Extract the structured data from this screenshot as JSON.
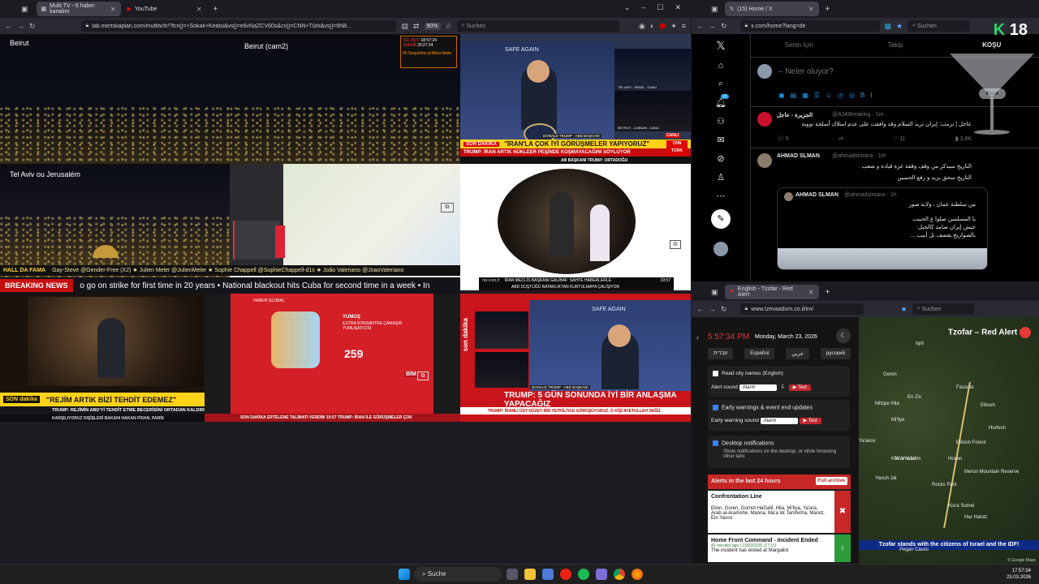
{
  "left_browser": {
    "tabs": [
      {
        "label": "Multi TV - 6 haber kanalını"
      },
      {
        "label": "YouTube"
      }
    ],
    "url": "lab.mertskaplan.com/multitv/tr/?fcn[]=+Sokak+Kedisi&vs[]=e6vNaZCV60s&cn[]=CNN+Türk&vs[]=6N8...",
    "zoom": "90%",
    "search_placeholder": "Suchen"
  },
  "tv_tiles": {
    "beirut": "Beirut",
    "beirut_cam2": "Beirut (cam2)",
    "tel_aviv": "Tel Aviv ou Jerusalém",
    "clock_city1": "TEL AVIV",
    "clock_time1": "18:57:24",
    "clock_city2": "TEERÃ",
    "clock_time2": "20:27:24",
    "clock_note": "05 Segundos pl Meia-Noite",
    "cnn_son_dakika": "SON DAKİKA",
    "cnn_headline": "\"İRAN'LA ÇOK İYİ GÖRÜŞMELER YAPIYORUZ\"",
    "cnn_sub": "TRUMP: İRAN ARTIK NÜKLEER PEŞİNDE KOŞMAYACAĞINI SÖYLÜYOR",
    "cnn_canli": "CANLI",
    "cnn_logo": "CNN TÜRK",
    "cnn_label": "DONALD TRUMP - ABD BAŞKANI",
    "cnn_lower": "AB BAŞKANI TRUMP: ORTADOĞU",
    "cam_label1": "TEL AVİV - İSRAİL - CANLI",
    "cam_label2": "BEYRUT - LÜBNAN - CANLI",
    "ntv_line1": "İRAN MECLİS BAŞKANI GALİBAF: SAHTE HABERLERLE",
    "ntv_line2": "ABD DÜŞTÜĞÜ BATAKLIKTAN KURTULMAYA ÇALIŞIYOR",
    "ntv_time": "19:57",
    "ntv_url": "ntv.com.tr",
    "hall_of_fame": "HALL DA FAMA",
    "hof_names": "Gay-Steve @Gender-Free (X2)  ★  Julien Meler @JulienMeler  ★  Sophie Chappell @SophieChappell-d1s  ★  João Valeriano @JoaoValeriano",
    "breaking_label": "BREAKING NEWS",
    "breaking_text": "o go on strike for first time in 20 years   •   National blackout hits Cuba for second time in a week   •   In",
    "son_dakika_lt": "SON dakika",
    "rejim_headline": "\"REJİM ARTIK BİZİ TEHDİT EDEMEZ\"",
    "rejim_sub": "TRUMP: REJİMİN ABD'Yİ TEHDİT ETME BECERİSİNİ ORTADAN KALDIRDIK",
    "rejim_ticker": "KARŞILIYORUZ     DIŞİŞLERİ BAKANI HAKAN FİDAN, PARİS",
    "ad_brand": "YUMOŞ",
    "ad_text": "EXTRA KONSANTRE ÇAMAŞIR YUMUŞATICISI",
    "ad_price": "259",
    "ad_store": "BİM",
    "ht_ticker": "SON DAKİKA   ERTELENE TALİMATI VERDİM   19:57   TRUMP: İRAN İLE GÖRÜŞMELER ÇOK",
    "haber_label": "HABER GLOBAL",
    "sondakika_side": "son dakika",
    "bottom_right_headline": "TRUMP: 5 GÜN SONUNDA İYİ BİR ANLAŞMA YAPACAĞIZ",
    "bottom_right_ticker": "TRUMP: İRANLI ÜST DÜZEY BİR YETKİLİYLE GÖRÜŞÜYORUZ, O KİŞİ AYETULLAH DEĞİL",
    "bottom_right_label": "DONALD TRUMP - ABD BAŞKANI",
    "safe_again": "SAFE AGAIN"
  },
  "x_browser": {
    "tab_label": "(15) Home / X",
    "url": "x.com/home?lang=de",
    "search_placeholder": "Suchen",
    "tabs": [
      "Senin İçin",
      "Takip",
      "KOŞU"
    ],
    "compose_placeholder": "– Neler oluyor?",
    "post_button": "Post",
    "tweet1_name": "الجزيرة - عاجل",
    "tweet1_handle": "@AJABreaking · 1m",
    "tweet1_text": "عاجل | ترمب: إيران تريد السلام وقد وافقت على عدم امتلاك أسلحة نووية",
    "tweet1_stats": [
      "5",
      "",
      "11",
      "3,8K"
    ],
    "tweet2_name": "AHMAD SLMAN",
    "tweet2_handle": "@ahmadslmanx · 1m",
    "tweet2_text1": "التاريخ سيذكر من وقف وقفة عزة قيادة و شعب .",
    "tweet2_text2": "التاريخ سحق يزيد و رفع الحسين",
    "quote_name": "AHMAD SLMAN",
    "quote_handle": "@ahmadslmanx · 1h",
    "quote_line1": "من سلطنة عمان ، ولاية صور",
    "quote_line2": "يا المسلمين صلوا ع الحبيب",
    "quote_line3": "جيش إيران صامد كالجبل",
    "quote_line4": "بالصواريخ يقصف تل أبيب ...",
    "overlay_k": "K",
    "overlay_age": "18",
    "notification_count": "15"
  },
  "tzofar_browser": {
    "tab_label": "English - Tzofar - Red Alert",
    "url": "www.tzevaadom.co.il/en/",
    "search_placeholder": "Suchen",
    "time": "5:57:34 PM",
    "date": "Monday, March 23, 2026",
    "languages": [
      "עברית",
      "Español",
      "عربي",
      "русский"
    ],
    "read_city": "Read city names (English)",
    "alert_sound_label": "Alert sound",
    "alert_sound_value": "Alarm",
    "test_label": "Test",
    "early_warnings": "Early warnings & event end updates",
    "early_sound_label": "Early warning sound",
    "early_sound_value": "Alarm",
    "desktop_notif": "Desktop notifications",
    "desktop_sub": "Show notifications on the desktop, or while browsing other tabs",
    "alerts_title": "Alerts in the last 24 hours",
    "full_archive": "Full archive",
    "alert1_title": "Confrontation Line",
    "alert1_cities": "Eilon, Goren, Gornot HaGalil, Hila, Mi'ilya, Ya'ara, Arab al-Aramshe, Maona, Ma'a lot Tarshicha, Manot, Ein Yacov",
    "alert2_title": "Home Front Command - Incident Ended",
    "alert2_time": "42 minutes ago | 23/03/2026 (17:15)",
    "alert2_body": "The incident has ended at Margaliot",
    "map_title": "Tzofar – Red Alert",
    "map_banner": "Tzofar stands with the citizens of Israel and the IDF!",
    "map_places": [
      "Goren",
      "Fassuta",
      "Elkosh",
      "Mi'ilya",
      "Mitzpe Hila",
      "En Ziv",
      "Hurfesh",
      "Ya'akov",
      "Elkosh Forest",
      "Kfar Vradim",
      "Hosen",
      "Meron Mountain Reserve",
      "Yanuh Jat",
      "Rocks Park",
      "Kisra Sumei",
      "Har Halutz",
      "Pegan Caves",
      "Iqrit",
      "Kfar Vradim"
    ]
  },
  "taskbar": {
    "search_label": "Suche",
    "time": "17:57:34",
    "date": "23.03.2026"
  }
}
